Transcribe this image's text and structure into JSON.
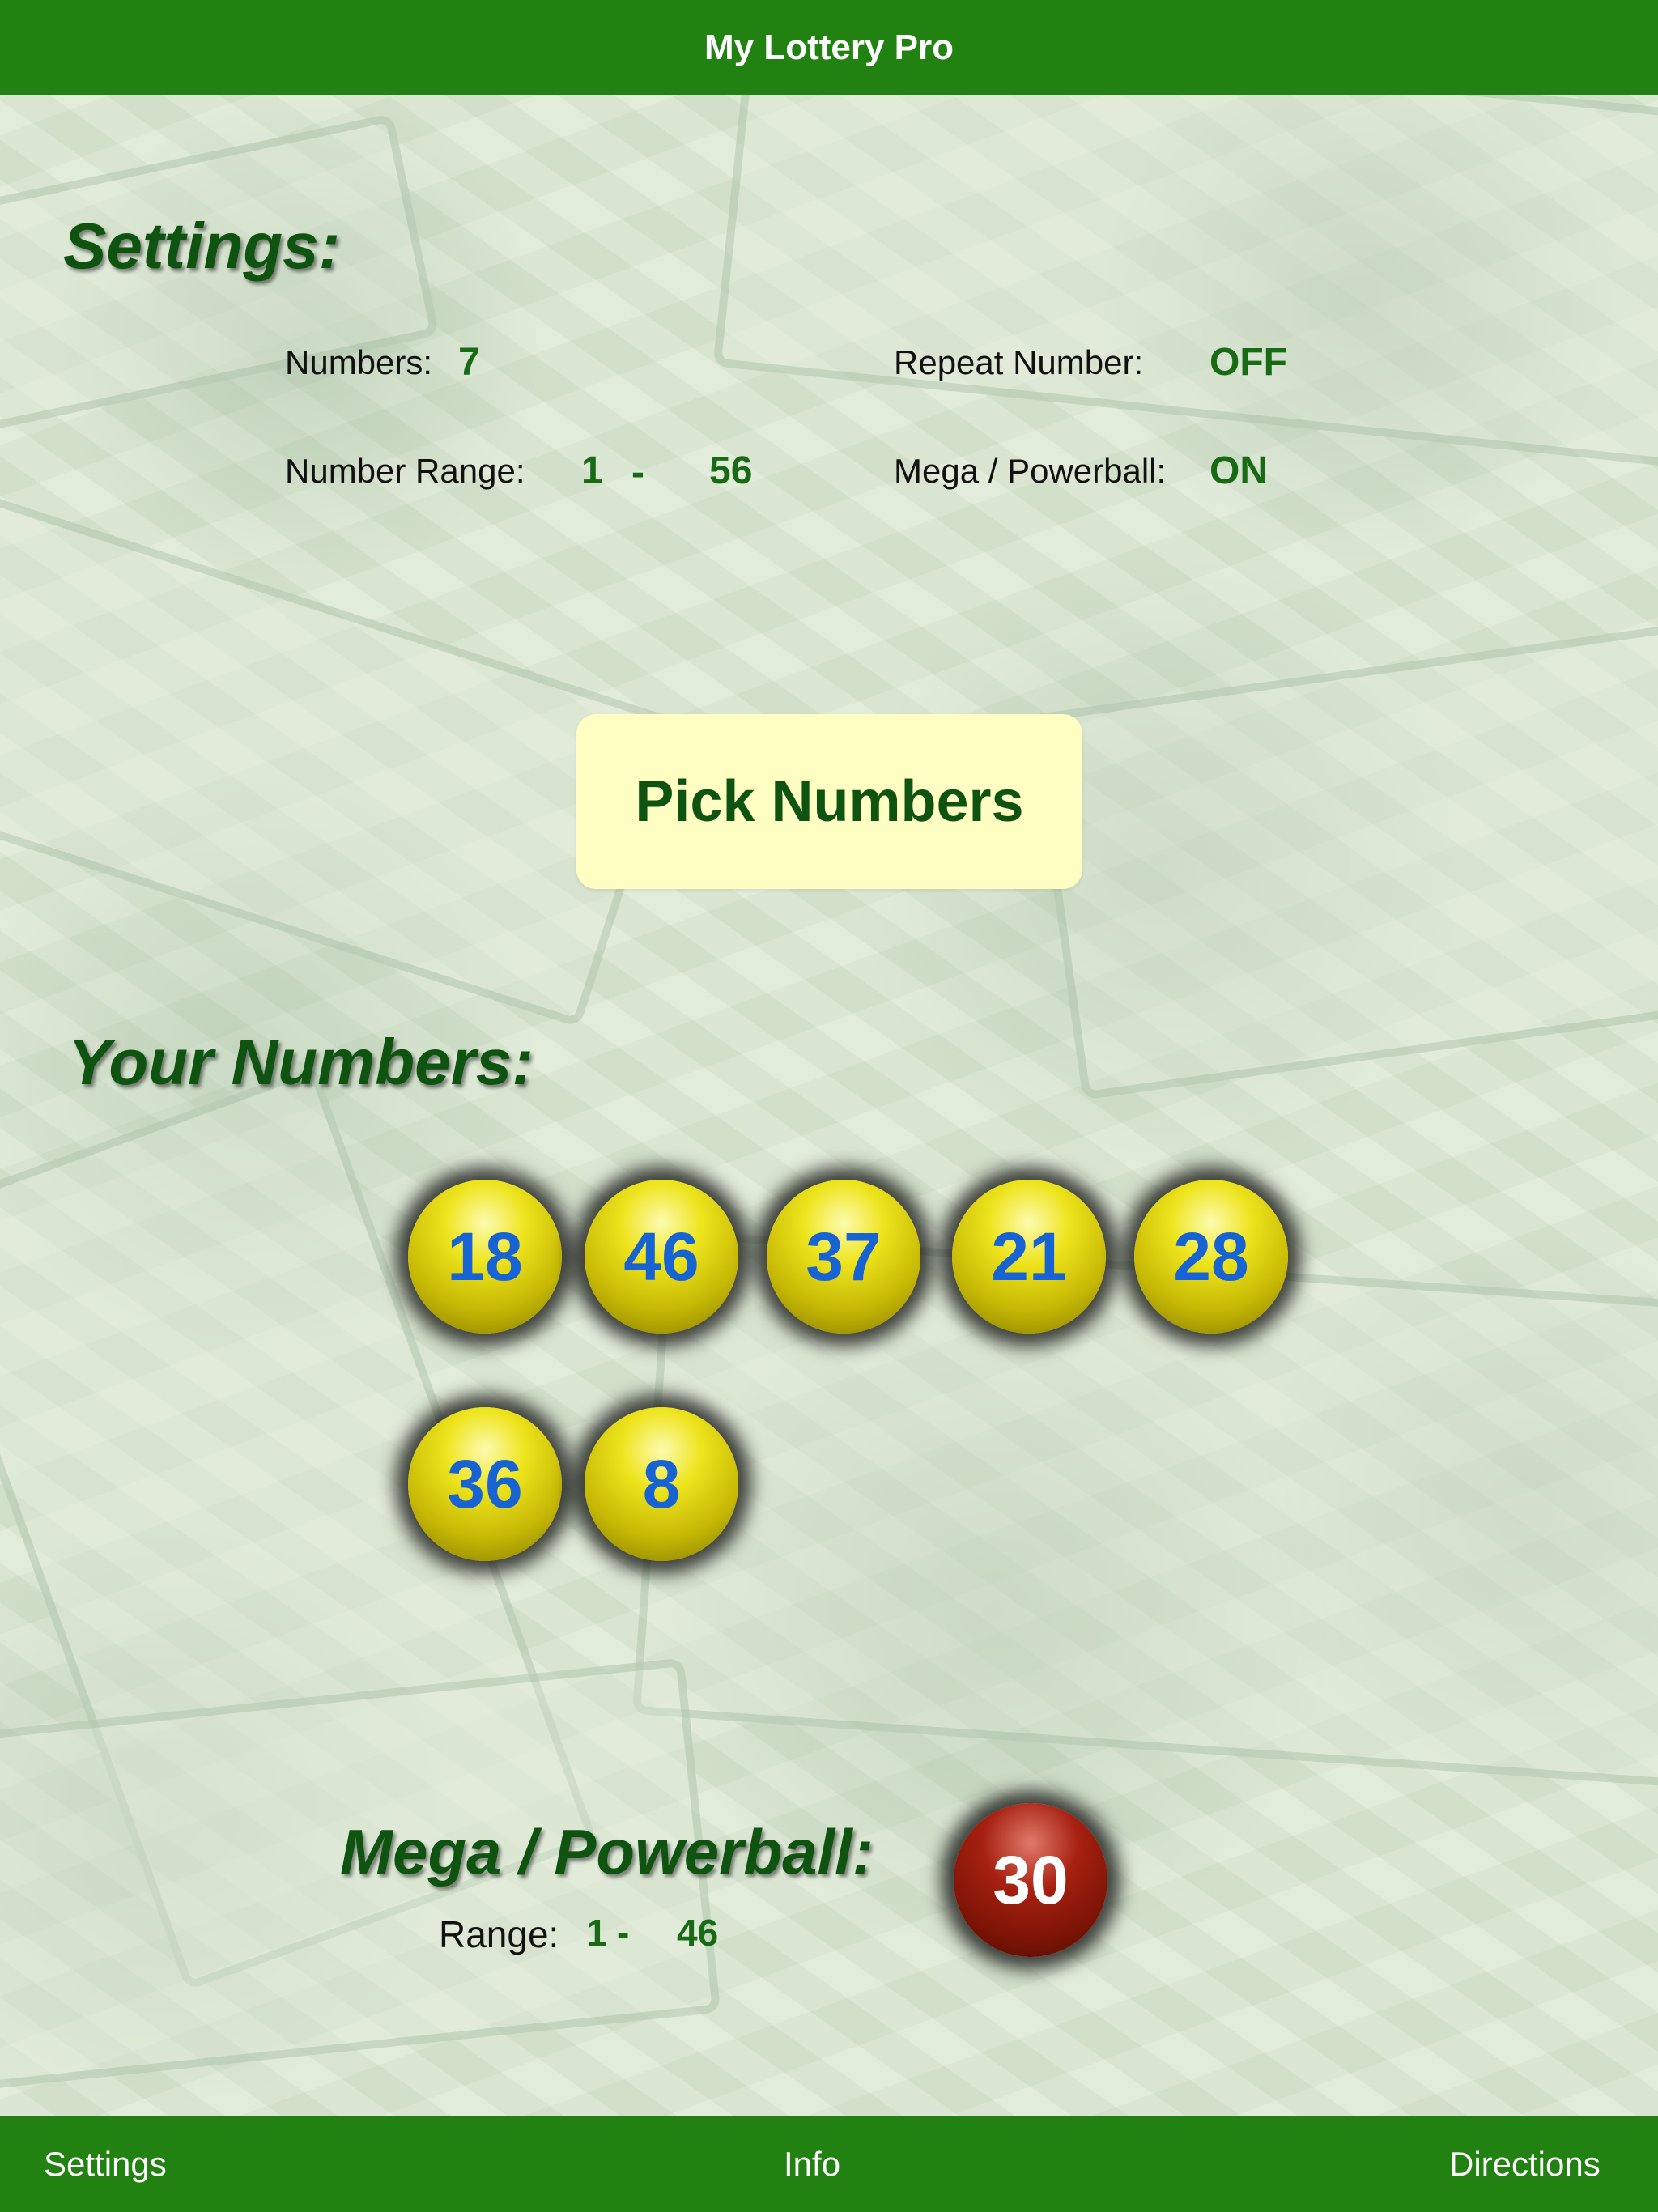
{
  "app": {
    "title": "My Lottery Pro"
  },
  "settings": {
    "heading": "Settings:",
    "numbers_label": "Numbers:",
    "numbers_value": "7",
    "range_label": "Number Range:",
    "range_min": "1",
    "range_sep": "-",
    "range_max": "56",
    "repeat_label": "Repeat Number:",
    "repeat_value": "OFF",
    "mega_label": "Mega / Powerball:",
    "mega_value": "ON"
  },
  "pick_button": {
    "label": "Pick Numbers"
  },
  "your_numbers": {
    "heading": "Your Numbers:",
    "balls": [
      "18",
      "46",
      "37",
      "21",
      "28",
      "36",
      "8"
    ]
  },
  "powerball": {
    "heading": "Mega / Powerball:",
    "range_label": "Range:",
    "range_min": "1",
    "range_sep": "-",
    "range_max": "46",
    "value": "30"
  },
  "tabbar": {
    "settings": "Settings",
    "info": "Info",
    "directions": "Directions"
  },
  "colors": {
    "bar_green": "#228211",
    "heading_green": "#0e5410",
    "value_green": "#186a14",
    "button_bg": "#ffffc4",
    "ball_number_blue": "#1863d4",
    "powerball_red": "#a62010"
  }
}
